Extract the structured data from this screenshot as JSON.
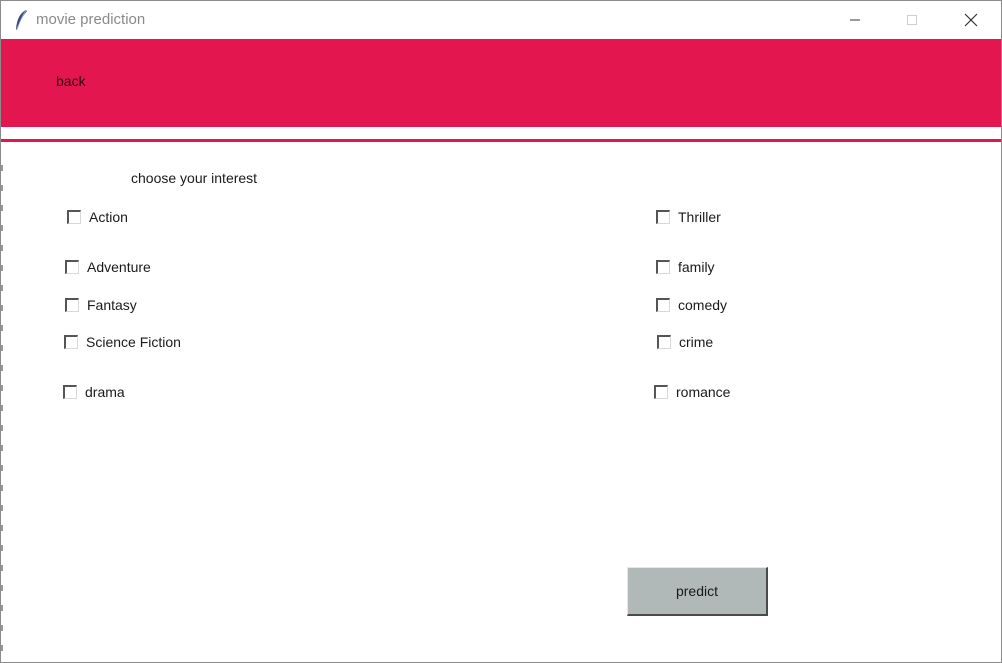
{
  "window": {
    "title": "movie prediction",
    "icons": {
      "app": "feather-icon",
      "minimize": "minimize-icon",
      "maximize": "maximize-icon",
      "close": "close-icon"
    }
  },
  "header": {
    "back_label": "back",
    "accent_color": "#e31650"
  },
  "main": {
    "heading": "choose your interest",
    "genres_left": [
      {
        "label": "Action",
        "checked": false
      },
      {
        "label": "Adventure",
        "checked": false
      },
      {
        "label": "Fantasy",
        "checked": false
      },
      {
        "label": "Science Fiction",
        "checked": false
      },
      {
        "label": "drama",
        "checked": false
      }
    ],
    "genres_right": [
      {
        "label": "Thriller",
        "checked": false
      },
      {
        "label": "family",
        "checked": false
      },
      {
        "label": "comedy",
        "checked": false
      },
      {
        "label": "crime",
        "checked": false
      },
      {
        "label": "romance",
        "checked": false
      }
    ],
    "predict_label": "predict",
    "button_color": "#b1b8b8"
  }
}
